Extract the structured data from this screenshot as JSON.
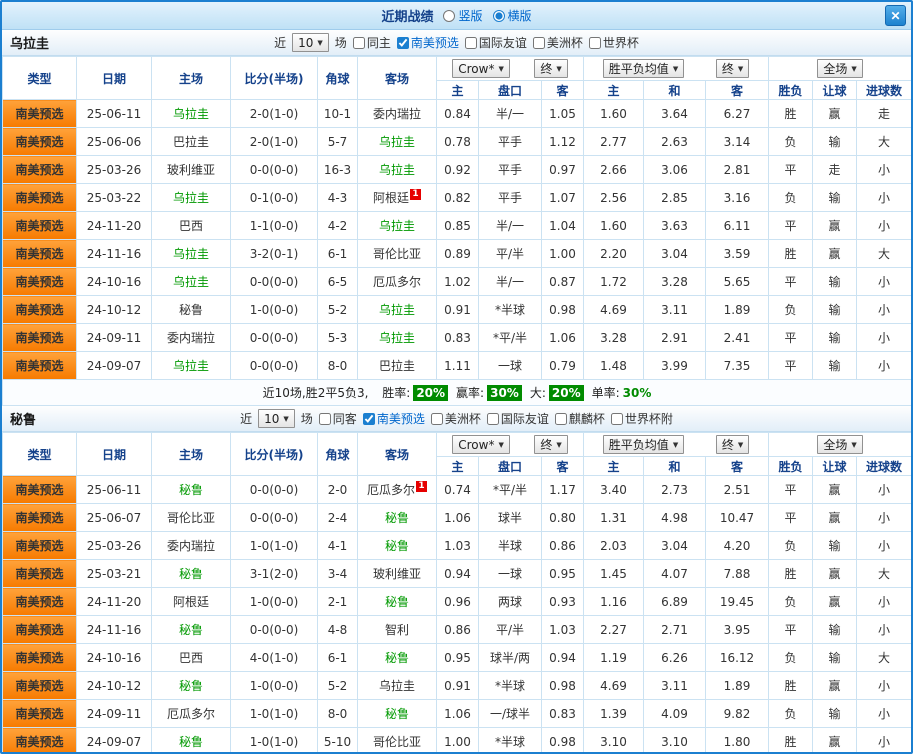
{
  "icons": {
    "chevron_down": "▼",
    "close": "✕"
  },
  "colors": {
    "panel_border": "#1b7fd0",
    "titlebar_title": "#15428b",
    "type_cell_orange": "#f67a00",
    "highlight_green": "#009900",
    "score_red": "#e60000",
    "result_red": "#e60000",
    "result_green": "#009900",
    "result_blue": "#0000ee",
    "badge_green": "#008b00",
    "link_blue": "#0066cc"
  },
  "titlebar": {
    "title": "近期战绩",
    "layout_options": [
      {
        "label": "竖版",
        "selected": false
      },
      {
        "label": "横版",
        "selected": true
      }
    ]
  },
  "table_header": {
    "cols": [
      "类型",
      "日期",
      "主场",
      "比分(半场)",
      "角球",
      "客场"
    ],
    "ah_group": {
      "source": "Crow*",
      "final": "终"
    },
    "odds_group": {
      "source": "胜平负均值",
      "final": "终"
    },
    "full_group": {
      "label": "全场"
    },
    "sub": [
      "主",
      "盘口",
      "客",
      "主",
      "和",
      "客",
      "胜负",
      "让球",
      "进球数"
    ]
  },
  "sections": [
    {
      "team": "乌拉圭",
      "filter": {
        "near_label": "近",
        "count": "10",
        "games_label": "场",
        "checkboxes": [
          {
            "label": "同主",
            "checked": false
          },
          {
            "label": "南美预选",
            "checked": true
          },
          {
            "label": "国际友谊",
            "checked": false
          },
          {
            "label": "美洲杯",
            "checked": false
          },
          {
            "label": "世界杯",
            "checked": false
          }
        ]
      },
      "rows": [
        {
          "type": "南美预选",
          "date": "25-06-11",
          "home": "乌拉圭",
          "home_hl": true,
          "score": "2-0(1-0)",
          "corner": "10-1",
          "away": "委内瑞拉",
          "away_hl": false,
          "ah": [
            "0.84",
            "半/一",
            "1.05"
          ],
          "ah_red": false,
          "odds": [
            "1.60",
            "3.64",
            "6.27"
          ],
          "r": [
            [
              "胜",
              "red"
            ],
            [
              "赢",
              "red"
            ],
            [
              "走",
              "blue"
            ]
          ]
        },
        {
          "type": "南美预选",
          "date": "25-06-06",
          "home": "巴拉圭",
          "home_hl": false,
          "score": "2-0(1-0)",
          "corner": "5-7",
          "away": "乌拉圭",
          "away_hl": true,
          "ah": [
            "0.78",
            "平手",
            "1.12"
          ],
          "ah_red": false,
          "odds": [
            "2.77",
            "2.63",
            "3.14"
          ],
          "r": [
            [
              "负",
              "green"
            ],
            [
              "输",
              "green"
            ],
            [
              "大",
              "red"
            ]
          ]
        },
        {
          "type": "南美预选",
          "date": "25-03-26",
          "home": "玻利维亚",
          "home_hl": false,
          "score": "0-0(0-0)",
          "corner": "16-3",
          "away": "乌拉圭",
          "away_hl": true,
          "ah": [
            "0.92",
            "平手",
            "0.97"
          ],
          "ah_red": false,
          "odds": [
            "2.66",
            "3.06",
            "2.81"
          ],
          "r": [
            [
              "平",
              "blue"
            ],
            [
              "走",
              "blue"
            ],
            [
              "小",
              "green"
            ]
          ]
        },
        {
          "type": "南美预选",
          "date": "25-03-22",
          "home": "乌拉圭",
          "home_hl": true,
          "score": "0-1(0-0)",
          "corner": "4-3",
          "away": "阿根廷",
          "away_hl": false,
          "away_badge": "1",
          "ah": [
            "0.82",
            "平手",
            "1.07"
          ],
          "ah_red": false,
          "odds": [
            "2.56",
            "2.85",
            "3.16"
          ],
          "r": [
            [
              "负",
              "green"
            ],
            [
              "输",
              "green"
            ],
            [
              "小",
              "green"
            ]
          ]
        },
        {
          "type": "南美预选",
          "date": "24-11-20",
          "home": "巴西",
          "home_hl": false,
          "score": "1-1(0-0)",
          "corner": "4-2",
          "away": "乌拉圭",
          "away_hl": true,
          "ah": [
            "0.85",
            "半/一",
            "1.04"
          ],
          "ah_red": false,
          "odds": [
            "1.60",
            "3.63",
            "6.11"
          ],
          "r": [
            [
              "平",
              "blue"
            ],
            [
              "赢",
              "red"
            ],
            [
              "小",
              "green"
            ]
          ]
        },
        {
          "type": "南美预选",
          "date": "24-11-16",
          "home": "乌拉圭",
          "home_hl": true,
          "score": "3-2(0-1)",
          "corner": "6-1",
          "away": "哥伦比亚",
          "away_hl": false,
          "ah": [
            "0.89",
            "平/半",
            "1.00"
          ],
          "ah_red": false,
          "odds": [
            "2.20",
            "3.04",
            "3.59"
          ],
          "r": [
            [
              "胜",
              "red"
            ],
            [
              "赢",
              "red"
            ],
            [
              "大",
              "red"
            ]
          ]
        },
        {
          "type": "南美预选",
          "date": "24-10-16",
          "home": "乌拉圭",
          "home_hl": true,
          "score": "0-0(0-0)",
          "corner": "6-5",
          "away": "厄瓜多尔",
          "away_hl": false,
          "ah": [
            "1.02",
            "半/一",
            "0.87"
          ],
          "ah_red": false,
          "odds": [
            "1.72",
            "3.28",
            "5.65"
          ],
          "r": [
            [
              "平",
              "blue"
            ],
            [
              "输",
              "green"
            ],
            [
              "小",
              "green"
            ]
          ]
        },
        {
          "type": "南美预选",
          "date": "24-10-12",
          "home": "秘鲁",
          "home_hl": false,
          "score": "1-0(0-0)",
          "corner": "5-2",
          "away": "乌拉圭",
          "away_hl": true,
          "ah": [
            "0.91",
            "*半球",
            "0.98"
          ],
          "ah_red": true,
          "odds": [
            "4.69",
            "3.11",
            "1.89"
          ],
          "r": [
            [
              "负",
              "green"
            ],
            [
              "输",
              "green"
            ],
            [
              "小",
              "green"
            ]
          ]
        },
        {
          "type": "南美预选",
          "date": "24-09-11",
          "home": "委内瑞拉",
          "home_hl": false,
          "score": "0-0(0-0)",
          "corner": "5-3",
          "away": "乌拉圭",
          "away_hl": true,
          "ah": [
            "0.83",
            "*平/半",
            "1.06"
          ],
          "ah_red": true,
          "odds": [
            "3.28",
            "2.91",
            "2.41"
          ],
          "r": [
            [
              "平",
              "blue"
            ],
            [
              "输",
              "green"
            ],
            [
              "小",
              "green"
            ]
          ]
        },
        {
          "type": "南美预选",
          "date": "24-09-07",
          "home": "乌拉圭",
          "home_hl": true,
          "score": "0-0(0-0)",
          "corner": "8-0",
          "away": "巴拉圭",
          "away_hl": false,
          "ah": [
            "1.11",
            "一球",
            "0.79"
          ],
          "ah_red": false,
          "odds": [
            "1.48",
            "3.99",
            "7.35"
          ],
          "r": [
            [
              "平",
              "blue"
            ],
            [
              "输",
              "green"
            ],
            [
              "小",
              "green"
            ]
          ]
        }
      ],
      "summary": {
        "record_text": "近10场,胜2平5负3, ",
        "items": [
          {
            "label": "胜率:",
            "value": "20%",
            "badge": true
          },
          {
            "label": "赢率:",
            "value": "30%",
            "badge": true
          },
          {
            "label": "大:",
            "value": "20%",
            "badge": true
          },
          {
            "label": "单率:",
            "value": "30%",
            "badge": false
          }
        ]
      }
    },
    {
      "team": "秘鲁",
      "filter": {
        "near_label": "近",
        "count": "10",
        "games_label": "场",
        "checkboxes": [
          {
            "label": "同客",
            "checked": false
          },
          {
            "label": "南美预选",
            "checked": true
          },
          {
            "label": "美洲杯",
            "checked": false
          },
          {
            "label": "国际友谊",
            "checked": false
          },
          {
            "label": "麒麟杯",
            "checked": false
          },
          {
            "label": "世界杯附",
            "checked": false
          }
        ]
      },
      "rows": [
        {
          "type": "南美预选",
          "date": "25-06-11",
          "home": "秘鲁",
          "home_hl": true,
          "score": "0-0(0-0)",
          "corner": "2-0",
          "away": "厄瓜多尔",
          "away_hl": false,
          "away_badge": "1",
          "ah": [
            "0.74",
            "*平/半",
            "1.17"
          ],
          "ah_red": true,
          "odds": [
            "3.40",
            "2.73",
            "2.51"
          ],
          "r": [
            [
              "平",
              "blue"
            ],
            [
              "赢",
              "red"
            ],
            [
              "小",
              "green"
            ]
          ]
        },
        {
          "type": "南美预选",
          "date": "25-06-07",
          "home": "哥伦比亚",
          "home_hl": false,
          "score": "0-0(0-0)",
          "corner": "2-4",
          "away": "秘鲁",
          "away_hl": true,
          "ah": [
            "1.06",
            "球半",
            "0.80"
          ],
          "ah_red": false,
          "odds": [
            "1.31",
            "4.98",
            "10.47"
          ],
          "r": [
            [
              "平",
              "blue"
            ],
            [
              "赢",
              "red"
            ],
            [
              "小",
              "green"
            ]
          ]
        },
        {
          "type": "南美预选",
          "date": "25-03-26",
          "home": "委内瑞拉",
          "home_hl": false,
          "score": "1-0(1-0)",
          "corner": "4-1",
          "away": "秘鲁",
          "away_hl": true,
          "ah": [
            "1.03",
            "半球",
            "0.86"
          ],
          "ah_red": false,
          "odds": [
            "2.03",
            "3.04",
            "4.20"
          ],
          "r": [
            [
              "负",
              "green"
            ],
            [
              "输",
              "green"
            ],
            [
              "小",
              "green"
            ]
          ]
        },
        {
          "type": "南美预选",
          "date": "25-03-21",
          "home": "秘鲁",
          "home_hl": true,
          "score": "3-1(2-0)",
          "corner": "3-4",
          "away": "玻利维亚",
          "away_hl": false,
          "ah": [
            "0.94",
            "一球",
            "0.95"
          ],
          "ah_red": false,
          "odds": [
            "1.45",
            "4.07",
            "7.88"
          ],
          "r": [
            [
              "胜",
              "red"
            ],
            [
              "赢",
              "red"
            ],
            [
              "大",
              "red"
            ]
          ]
        },
        {
          "type": "南美预选",
          "date": "24-11-20",
          "home": "阿根廷",
          "home_hl": false,
          "score": "1-0(0-0)",
          "corner": "2-1",
          "away": "秘鲁",
          "away_hl": true,
          "ah": [
            "0.96",
            "两球",
            "0.93"
          ],
          "ah_red": false,
          "odds": [
            "1.16",
            "6.89",
            "19.45"
          ],
          "r": [
            [
              "负",
              "green"
            ],
            [
              "赢",
              "red"
            ],
            [
              "小",
              "green"
            ]
          ]
        },
        {
          "type": "南美预选",
          "date": "24-11-16",
          "home": "秘鲁",
          "home_hl": true,
          "score": "0-0(0-0)",
          "corner": "4-8",
          "away": "智利",
          "away_hl": false,
          "ah": [
            "0.86",
            "平/半",
            "1.03"
          ],
          "ah_red": false,
          "odds": [
            "2.27",
            "2.71",
            "3.95"
          ],
          "r": [
            [
              "平",
              "blue"
            ],
            [
              "输",
              "green"
            ],
            [
              "小",
              "green"
            ]
          ]
        },
        {
          "type": "南美预选",
          "date": "24-10-16",
          "home": "巴西",
          "home_hl": false,
          "score": "4-0(1-0)",
          "corner": "6-1",
          "away": "秘鲁",
          "away_hl": true,
          "ah": [
            "0.95",
            "球半/两",
            "0.94"
          ],
          "ah_red": false,
          "odds": [
            "1.19",
            "6.26",
            "16.12"
          ],
          "r": [
            [
              "负",
              "green"
            ],
            [
              "输",
              "green"
            ],
            [
              "大",
              "red"
            ]
          ]
        },
        {
          "type": "南美预选",
          "date": "24-10-12",
          "home": "秘鲁",
          "home_hl": true,
          "score": "1-0(0-0)",
          "corner": "5-2",
          "away": "乌拉圭",
          "away_hl": false,
          "ah": [
            "0.91",
            "*半球",
            "0.98"
          ],
          "ah_red": true,
          "odds": [
            "4.69",
            "3.11",
            "1.89"
          ],
          "r": [
            [
              "胜",
              "red"
            ],
            [
              "赢",
              "red"
            ],
            [
              "小",
              "green"
            ]
          ]
        },
        {
          "type": "南美预选",
          "date": "24-09-11",
          "home": "厄瓜多尔",
          "home_hl": false,
          "score": "1-0(1-0)",
          "corner": "8-0",
          "away": "秘鲁",
          "away_hl": true,
          "ah": [
            "1.06",
            "一/球半",
            "0.83"
          ],
          "ah_red": false,
          "odds": [
            "1.39",
            "4.09",
            "9.82"
          ],
          "r": [
            [
              "负",
              "green"
            ],
            [
              "输",
              "green"
            ],
            [
              "小",
              "green"
            ]
          ]
        },
        {
          "type": "南美预选",
          "date": "24-09-07",
          "home": "秘鲁",
          "home_hl": true,
          "score": "1-0(1-0)",
          "corner": "5-10",
          "away": "哥伦比亚",
          "away_hl": false,
          "ah": [
            "1.00",
            "*半球",
            "0.98"
          ],
          "ah_red": true,
          "odds": [
            "3.10",
            "3.10",
            "1.80"
          ],
          "r": [
            [
              "胜",
              "red"
            ],
            [
              "赢",
              "red"
            ],
            [
              "小",
              "green"
            ]
          ]
        }
      ]
    }
  ]
}
